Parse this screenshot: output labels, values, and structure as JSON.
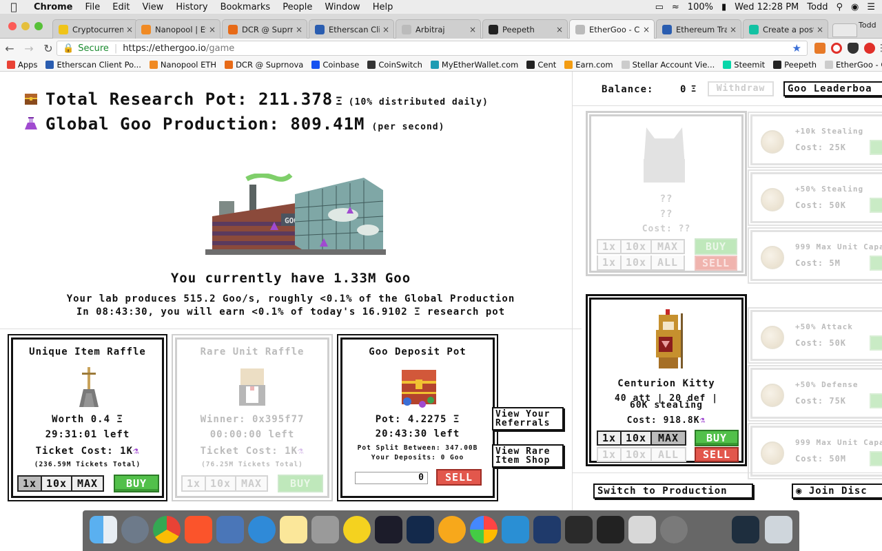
{
  "menubar": {
    "app": "Chrome",
    "items": [
      "File",
      "Edit",
      "View",
      "History",
      "Bookmarks",
      "People",
      "Window",
      "Help"
    ],
    "battery": "100%",
    "clock": "Wed 12:28 PM",
    "user": "Todd"
  },
  "tabs": [
    {
      "label": "Cryptocurrency",
      "color": "#f0c419"
    },
    {
      "label": "Nanopool | Eth",
      "color": "#f08a24"
    },
    {
      "label": "DCR @ Suprnova",
      "color": "#e76a17"
    },
    {
      "label": "Etherscan Clien",
      "color": "#2a5db0"
    },
    {
      "label": "Arbitraj",
      "color": "#bbbbbb"
    },
    {
      "label": "Peepeth",
      "color": "#222222"
    },
    {
      "label": "EtherGoo - Cryp",
      "color": "#bbbbbb"
    },
    {
      "label": "Ethereum Trans",
      "color": "#2a5db0"
    },
    {
      "label": "Create a post -",
      "color": "#13c2a3"
    }
  ],
  "profile_name": "Todd",
  "address": {
    "secure": "Secure",
    "host": "https://ethergoo.io",
    "path": "/game"
  },
  "bookmarks": [
    {
      "label": "Apps",
      "color": "#e94235"
    },
    {
      "label": "Etherscan Client Po...",
      "color": "#2a5db0"
    },
    {
      "label": "Nanopool ETH",
      "color": "#f08a24"
    },
    {
      "label": "DCR @ Suprnova",
      "color": "#e76a17"
    },
    {
      "label": "Coinbase",
      "color": "#1652f0"
    },
    {
      "label": "CoinSwitch",
      "color": "#333333"
    },
    {
      "label": "MyEtherWallet.com",
      "color": "#1d9cb3"
    },
    {
      "label": "Cent",
      "color": "#222222"
    },
    {
      "label": "Earn.com",
      "color": "#f39c12"
    },
    {
      "label": "Stellar Account Vie...",
      "color": "#cccccc"
    },
    {
      "label": "Steemit",
      "color": "#06d6a9"
    },
    {
      "label": "Peepeth",
      "color": "#222222"
    },
    {
      "label": "EtherGoo - Crypto I...",
      "color": "#cccccc"
    }
  ],
  "game": {
    "pot_label": "Total Research Pot:",
    "pot_value": "211.378",
    "eth_symbol": "Ξ",
    "pot_note": "(10% distributed daily)",
    "prod_label": "Global Goo Production:",
    "prod_value": "809.41M",
    "prod_note": "(per second)",
    "goo_have": "You currently have 1.33M Goo",
    "lab_line1": "Your lab produces 515.2 Goo/s, roughly <0.1% of the Global Production",
    "lab_line2": "In 08:43:30, you will earn <0.1% of today's 16.9102 Ξ research pot"
  },
  "unique_raffle": {
    "title": "Unique Item Raffle",
    "worth": "Worth 0.4 Ξ",
    "time_left": "29:31:01 left",
    "ticket_cost": "Ticket Cost: 1K",
    "tickets_total": "(236.59M Tickets Total)",
    "qty": [
      "1x",
      "10x",
      "MAX"
    ],
    "buy": "BUY"
  },
  "rare_raffle": {
    "title": "Rare Unit Raffle",
    "winner": "Winner: 0x395f77",
    "time_left": "00:00:00 left",
    "ticket_cost": "Ticket Cost: 1K",
    "tickets_total": "(76.25M Tickets Total)",
    "qty": [
      "1x",
      "10x",
      "MAX"
    ],
    "buy": "BUY"
  },
  "deposit_pot": {
    "title": "Goo Deposit Pot",
    "pot": "Pot: 4.2275 Ξ",
    "time_left": "20:43:30 left",
    "split": "Pot Split Between: 347.00B",
    "deposits": "Your Deposits: 0 Goo",
    "input_value": "0",
    "sell": "SELL"
  },
  "side_links": {
    "referrals": "View Your Referrals",
    "rare_shop": "View Rare Item Shop"
  },
  "sidebar": {
    "balance_label": "Balance:",
    "balance_value": "0",
    "eth_symbol": "Ξ",
    "withdraw": "Withdraw",
    "leaderboard": "Goo Leaderboa",
    "locked_unit": {
      "name": "??",
      "stats": "??",
      "cost": "Cost: ??",
      "qty_top": [
        "1x",
        "10x",
        "MAX"
      ],
      "qty_bottom": [
        "1x",
        "10x",
        "ALL"
      ],
      "buy": "BUY",
      "sell": "SELL"
    },
    "unit": {
      "name": "Centurion Kitty",
      "stats": "40 att | 20 def |",
      "stealing": "60K stealing",
      "cost": "Cost: 918.8K",
      "qty_top": [
        "1x",
        "10x",
        "MAX"
      ],
      "qty_bottom": [
        "1x",
        "10x",
        "ALL"
      ],
      "buy": "BUY",
      "sell": "SELL"
    },
    "upgrades": [
      {
        "name": "+10k Stealing",
        "cost": "Cost: 25K"
      },
      {
        "name": "+50% Stealing",
        "cost": "Cost: 50K"
      },
      {
        "name": "999 Max Unit Capa",
        "cost": "Cost: 5M"
      },
      {
        "name": "+50% Attack",
        "cost": "Cost: 50K"
      },
      {
        "name": "+50% Defense",
        "cost": "Cost: 75K"
      },
      {
        "name": "999 Max Unit Capa",
        "cost": "Cost: 50M"
      }
    ],
    "switch_btn": "Switch to Production",
    "discord_btn": "Join Disc"
  },
  "colors": {
    "buy_green": "#52c04a",
    "sell_red": "#e2574c",
    "secure_green": "#1a8a2f"
  }
}
